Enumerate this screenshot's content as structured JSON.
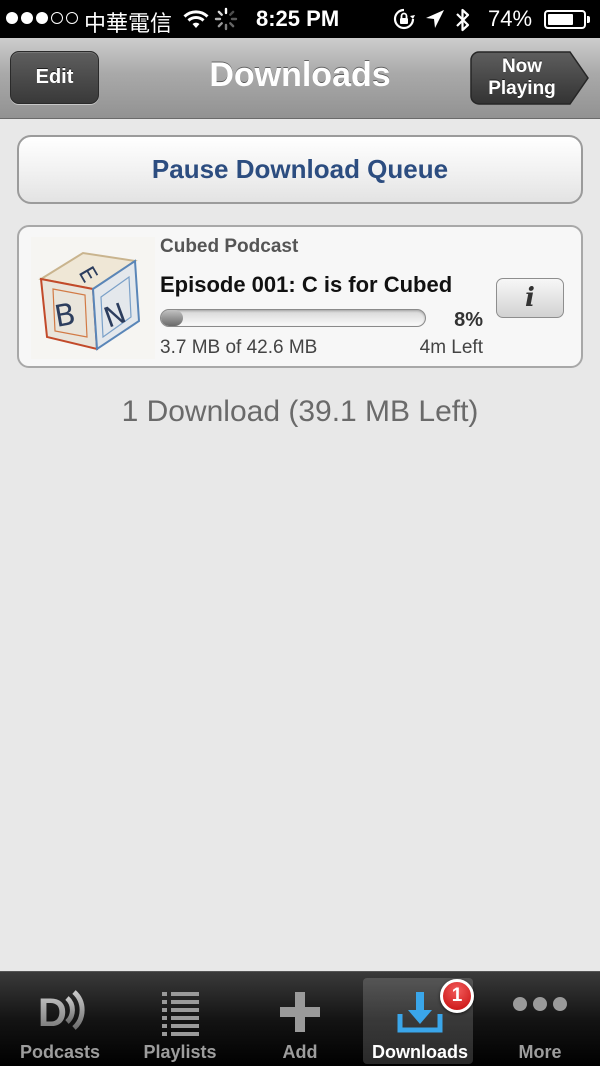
{
  "status_bar": {
    "carrier": "中華電信",
    "time": "8:25 PM",
    "battery_percent": "74%",
    "battery_level": 0.74,
    "signal_bars_filled": 3,
    "signal_bars_total": 5
  },
  "nav": {
    "title": "Downloads",
    "edit_label": "Edit",
    "now_playing_line1": "Now",
    "now_playing_line2": "Playing"
  },
  "pause_button_label": "Pause Download Queue",
  "download_item": {
    "podcast": "Cubed Podcast",
    "episode": "Episode 001: C is for Cubed",
    "progress_percent_label": "8%",
    "progress_fraction": 0.08,
    "size_text": "3.7 MB of 42.6 MB",
    "time_left": "4m Left",
    "info_label": "i"
  },
  "summary": "1 Download (39.1 MB Left)",
  "tabbar": {
    "tabs": [
      {
        "label": "Podcasts",
        "icon": "podcasts-icon"
      },
      {
        "label": "Playlists",
        "icon": "playlists-icon"
      },
      {
        "label": "Add",
        "icon": "add-icon"
      },
      {
        "label": "Downloads",
        "icon": "downloads-icon",
        "active": true,
        "badge": "1"
      },
      {
        "label": "More",
        "icon": "more-icon"
      }
    ]
  },
  "colors": {
    "accent_text": "#2c4d80",
    "badge_red": "#d41c1c",
    "download_icon_blue": "#3aa6ea"
  }
}
